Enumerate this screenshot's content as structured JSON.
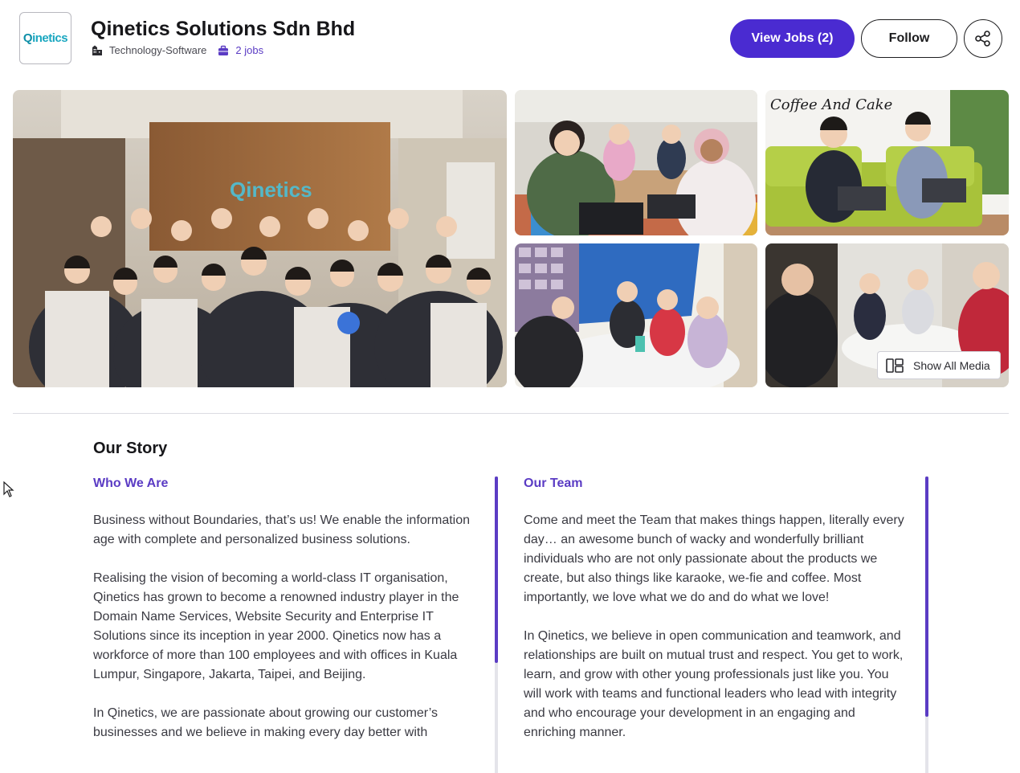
{
  "company": {
    "name": "Qinetics Solutions Sdn Bhd",
    "logo_text_q": "Q",
    "logo_text_rest": "inetics",
    "industry": "Technology-Software",
    "jobs_count_label": "2 jobs"
  },
  "actions": {
    "view_jobs_label": "View Jobs (2)",
    "follow_label": "Follow"
  },
  "gallery": {
    "show_all_label": "Show All Media",
    "main_wall_sign": "Qinetics",
    "cafe_sign": "Coffee And Cake"
  },
  "story": {
    "title": "Our Story",
    "who_we_are": {
      "heading": "Who We Are",
      "paragraphs": [
        "Business without Boundaries, that’s us! We enable the information age with complete and personalized business solutions.",
        "Realising the vision of becoming a world-class IT organisation, Qinetics has grown to become a renowned industry player in the Domain Name Services, Website Security and Enterprise IT Solutions since its inception in year 2000. Qinetics now has a workforce of more than 100 employees and with offices in Kuala Lumpur, Singapore, Jakarta, Taipei, and Beijing.",
        "In Qinetics, we are passionate about growing our customer’s businesses and we believe in making every day better with"
      ]
    },
    "our_team": {
      "heading": "Our Team",
      "paragraphs": [
        "Come and meet the Team that makes things happen, literally every day… an awesome bunch of wacky and wonderfully brilliant individuals who are not only passionate about the products we create, but also things like karaoke, we-fie and coffee. Most importantly, we love what we do and do what we love!",
        "In Qinetics, we believe in open communication and teamwork, and relationships are built on mutual trust and respect. You get to work, learn, and grow with other young professionals just like you. You will work with teams and functional leaders who lead with integrity and who encourage your development in an engaging and enriching manner."
      ]
    }
  },
  "colors": {
    "accent": "#4a2bd1",
    "accent_text": "#5b3cc4",
    "text": "#3a3a42"
  },
  "scroll": {
    "left_fraction": 0.63,
    "right_fraction": 0.81
  }
}
